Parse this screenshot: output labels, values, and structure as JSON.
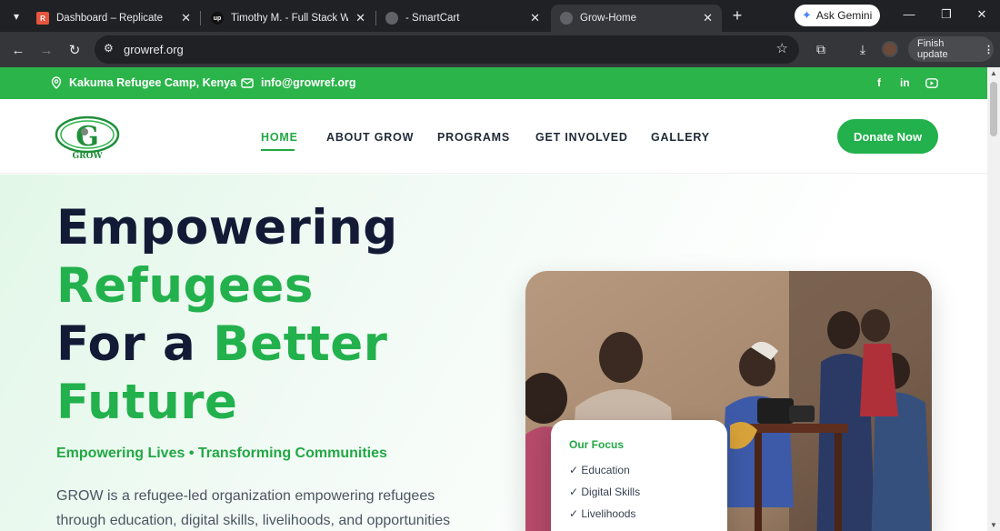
{
  "browser": {
    "tabs": [
      {
        "title": "Dashboard – Replicate",
        "favicon_color": "#e8553e",
        "favicon_glyph": "R"
      },
      {
        "title": "Timothy M. - Full Stack Web",
        "favicon_color": "#111111",
        "favicon_glyph": "up"
      },
      {
        "title": "- SmartCart",
        "favicon_color": "#5f6368",
        "favicon_glyph": "globe"
      },
      {
        "title": "Grow-Home",
        "favicon_color": "#5f6368",
        "favicon_glyph": "globe",
        "active": true
      }
    ],
    "ask_gemini": "Ask Gemini",
    "url": "growref.org",
    "finish_update": "Finish update"
  },
  "topbar": {
    "location": "Kakuma Refugee Camp, Kenya",
    "email": "info@growref.org",
    "socials": [
      "facebook-icon",
      "linkedin-icon",
      "youtube-icon"
    ],
    "brand_color": "#2bb44a"
  },
  "header": {
    "logo_text": "GROW",
    "nav": [
      "HOME",
      "ABOUT GROW",
      "PROGRAMS",
      "GET INVOLVED",
      "GALLERY"
    ],
    "active_nav": "HOME",
    "donate_label": "Donate Now"
  },
  "hero": {
    "line1": "Empowering",
    "line2": "Refugees",
    "line3a": "For a",
    "line3b": "Better",
    "line4": "Future",
    "tagline": "Empowering Lives • Transforming Communities",
    "description": "GROW is a refugee-led organization empowering refugees through education, digital skills, livelihoods, and opportunities",
    "focus_card": {
      "title": "Our Focus",
      "items": [
        "✓ Education",
        "✓ Digital Skills",
        "✓ Livelihoods"
      ]
    }
  }
}
